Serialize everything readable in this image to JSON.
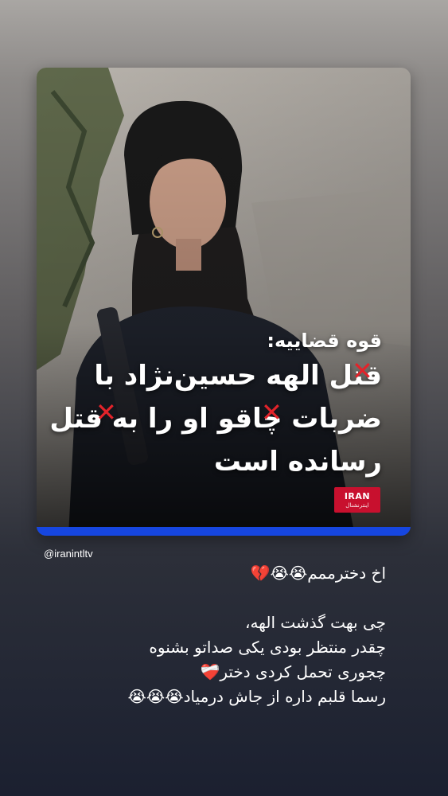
{
  "post": {
    "kicker": "قوه قضاییه:",
    "headline": "قتل الهه حسین‌نژاد با\nضربات چاقو او را به قتل\nرسانده است",
    "strike_mark": "✕",
    "logo_top": "IRAN",
    "logo_bottom": "اینترنشنال",
    "accent_color": "#1646e0",
    "strike_color": "#e3232a"
  },
  "story": {
    "mention": "@iranintltv",
    "caption_lines": [
      "اخ دخترممم😭😭💔",
      "",
      "چی بهت گذشت الهه،",
      "چقدر منتظر بودی یکی صداتو بشنوه",
      "چجوری تحمل کردی دختر❤️‍🩹",
      "رسما قلبم داره از جاش درمیاد😭😭😭"
    ]
  }
}
